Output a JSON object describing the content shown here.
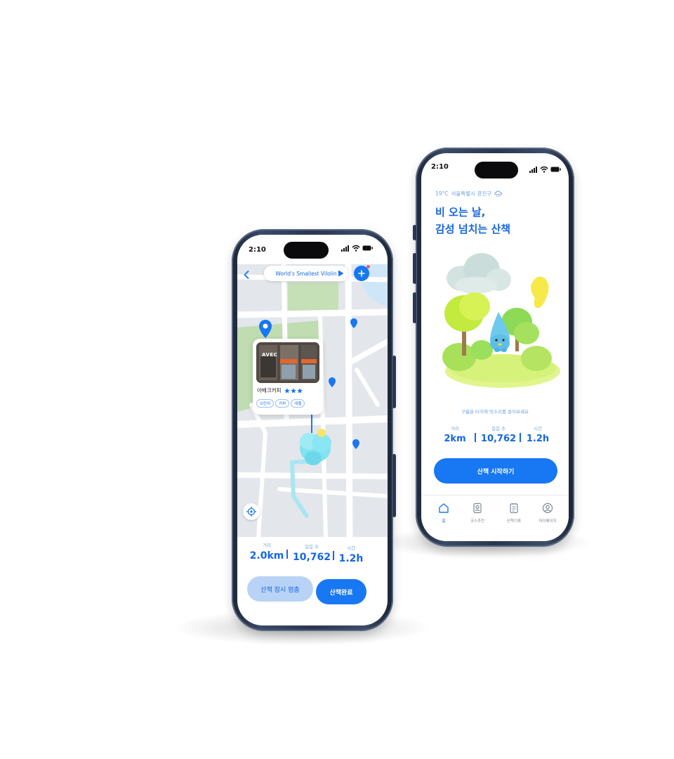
{
  "colors": {
    "primary": "#1877F2",
    "light_button": "#B8D3F6",
    "map_bg": "#E3E6EB",
    "road": "#FFFFFF",
    "park": "#BFDDB0",
    "text_blue": "#1567E0",
    "frame": "#2E3A52"
  },
  "left_phone": {
    "status": {
      "time": "2:10"
    },
    "header": {
      "track_title": "World's Smallest Vilolin",
      "back_icon": "chevron-left-icon",
      "play_icon": "play-icon",
      "add_icon": "plus-icon"
    },
    "place_card": {
      "name": "아베크커피",
      "rating_stars": 3,
      "tags": [
        "브런치",
        "커피",
        "데렐"
      ],
      "photo_sign": "AVEC"
    },
    "stats": [
      {
        "label": "거리",
        "value": "2.0km"
      },
      {
        "label": "걸음 수",
        "value": "10,762"
      },
      {
        "label": "시간",
        "value": "1.2h"
      }
    ],
    "buttons": {
      "pause": "산책 잠시 멈춤",
      "finish": "산책완료"
    }
  },
  "right_phone": {
    "status": {
      "time": "2:10"
    },
    "weather": {
      "temp": "19°C",
      "location": "서울특별시 광진구"
    },
    "headline": {
      "line1": "비 오는 날,",
      "line2": "감성 넘치는 산책"
    },
    "caption": "구름을 터치해 빗소리를 들어보세요",
    "stats": [
      {
        "label": "거리",
        "value": "2km"
      },
      {
        "label": "걸음 수",
        "value": "10,762"
      },
      {
        "label": "시간",
        "value": "1.2h"
      }
    ],
    "start_button": "산책 시작하기",
    "tabs": [
      {
        "label": "홈",
        "icon": "home-icon",
        "active": true
      },
      {
        "label": "코스추천",
        "icon": "location-icon",
        "active": false
      },
      {
        "label": "산책기록",
        "icon": "notes-icon",
        "active": false
      },
      {
        "label": "마이페이지",
        "icon": "user-icon",
        "active": false
      }
    ]
  }
}
